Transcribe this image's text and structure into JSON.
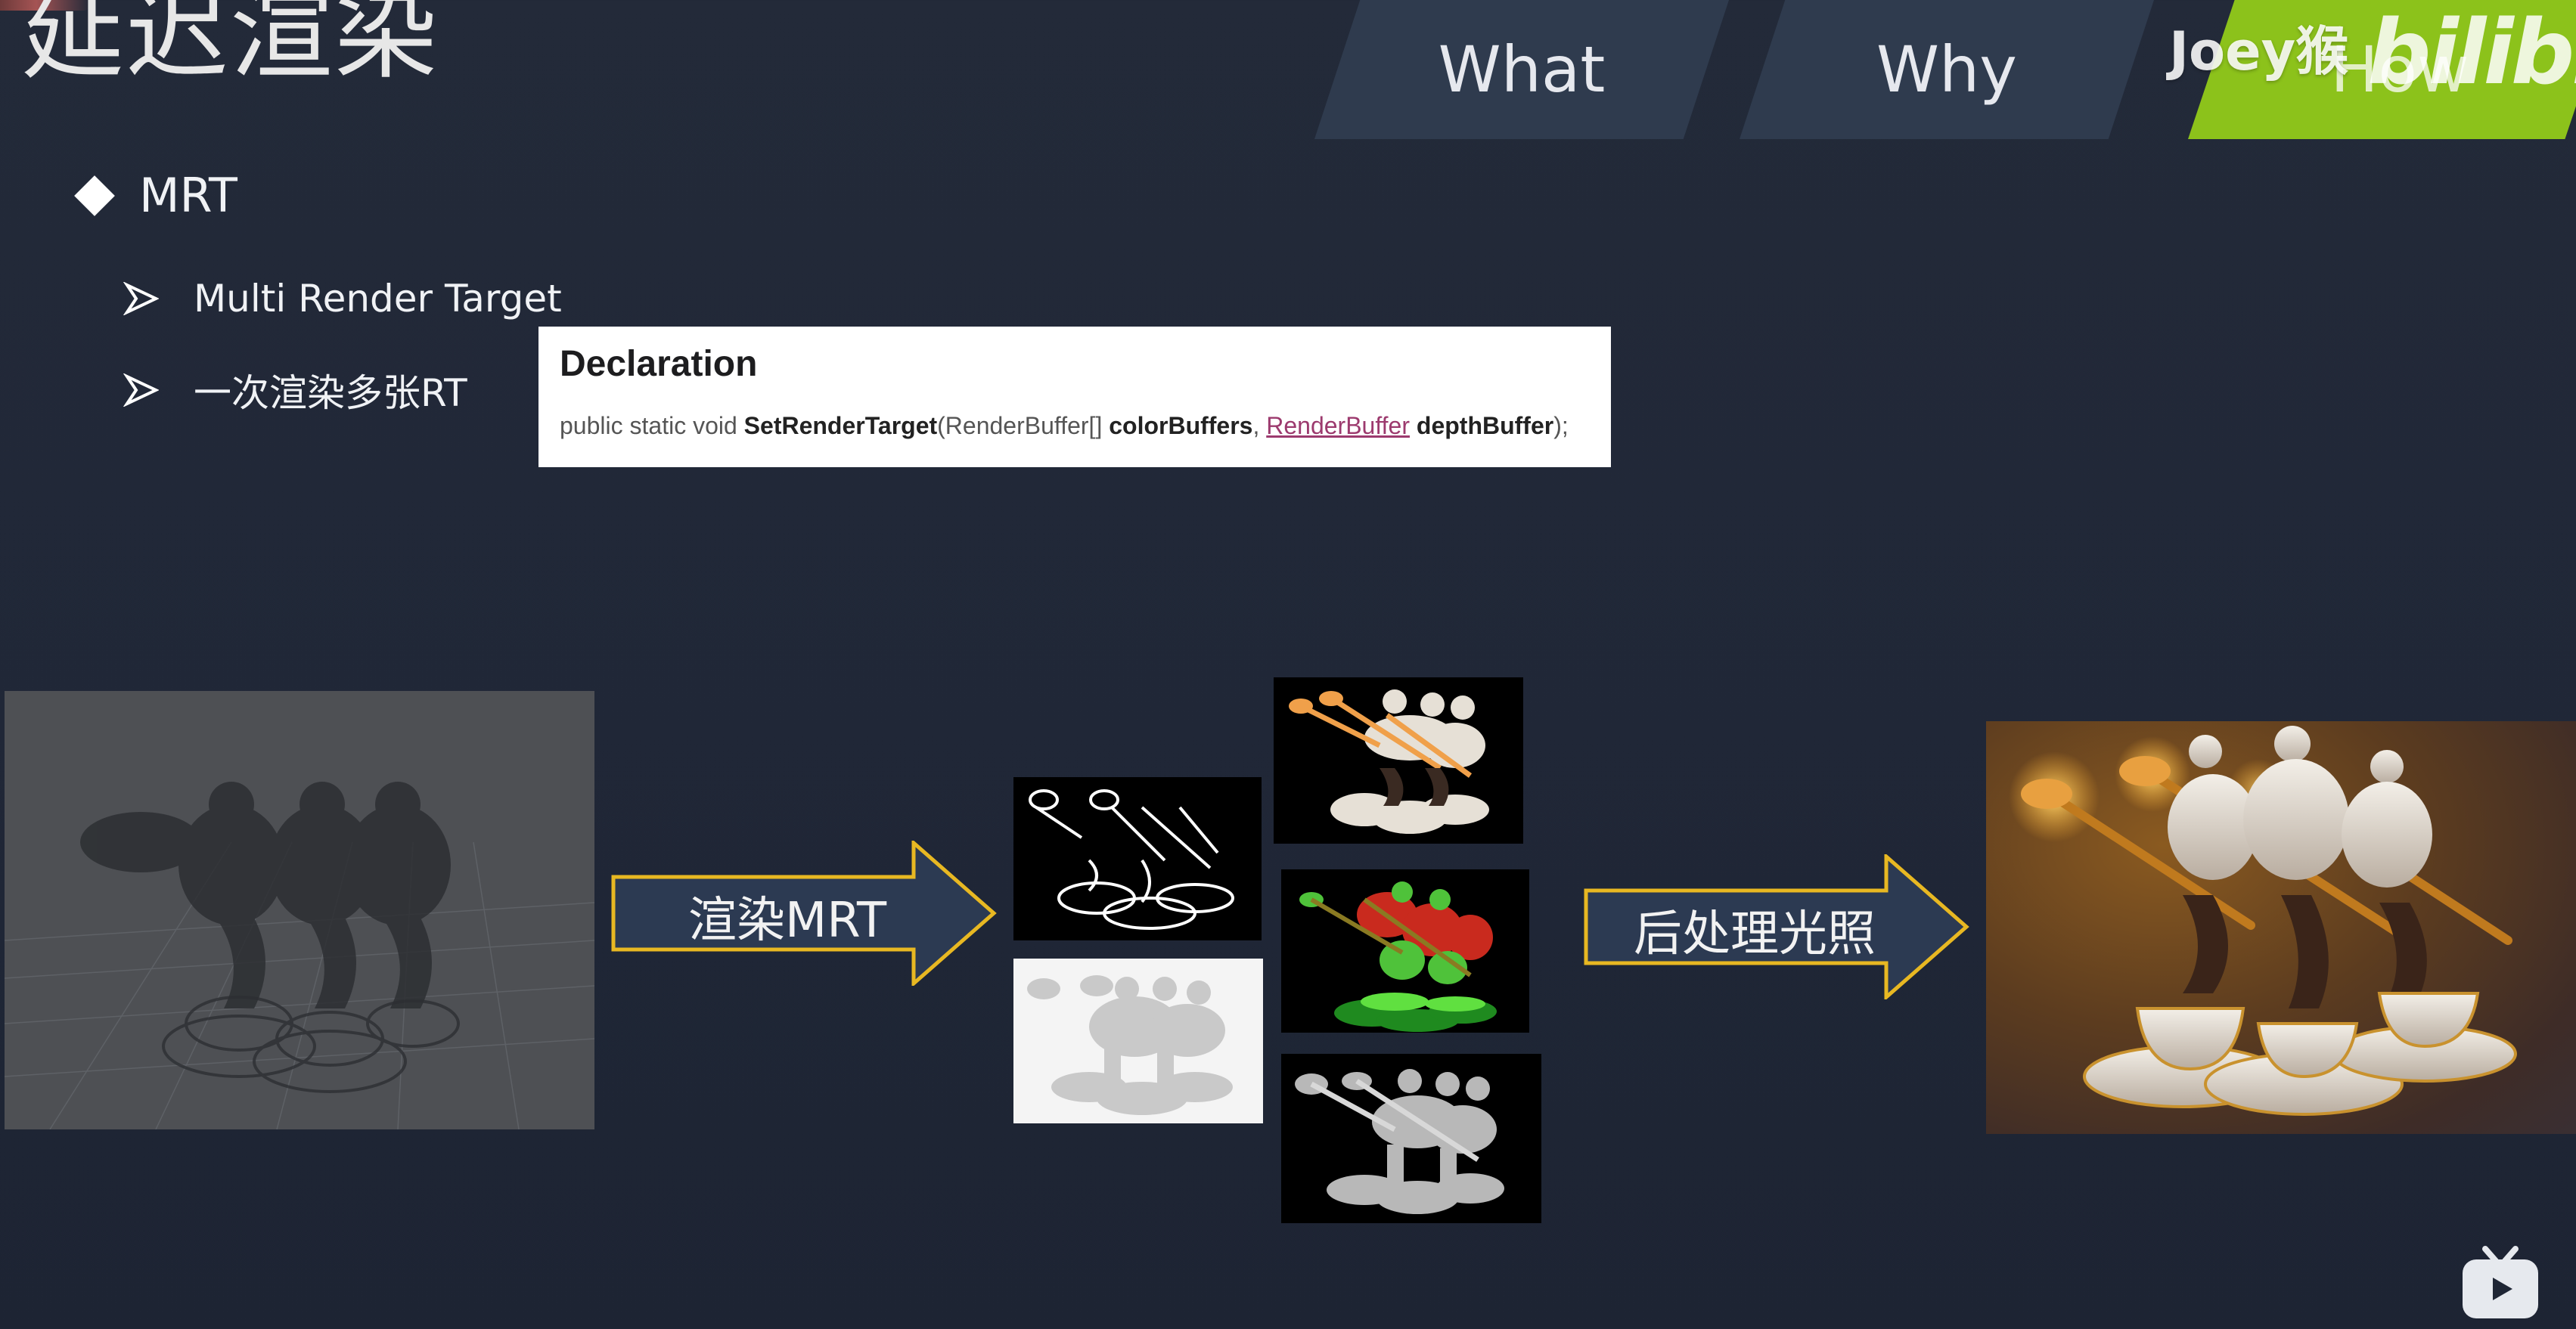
{
  "slide": {
    "title": "延迟渲染",
    "tabs": [
      "What",
      "Why",
      "How"
    ],
    "active_tab": "How",
    "bullet_main": "MRT",
    "sub_bullets": [
      "Multi Render Target",
      "一次渲染多张RT"
    ]
  },
  "declaration": {
    "heading": "Declaration",
    "code_prefix": "public static void ",
    "method": "SetRenderTarget",
    "open_paren": "(",
    "param1_type": "RenderBuffer[] ",
    "param1_name": "colorBuffers",
    "comma": ", ",
    "param2_type": "RenderBuffer",
    "param2_name": " depthBuffer",
    "close": ");"
  },
  "diagram": {
    "arrow1_label": "渲染MRT",
    "arrow2_label": "后处理光照"
  },
  "watermark": {
    "user": "Joey猴",
    "logo": "bilibili"
  },
  "colors": {
    "background": "#212838",
    "tab": "#2f3b4e",
    "tab_active": "#8cc21b",
    "arrow_fill": "#2c3a52",
    "arrow_stroke": "#e8b822",
    "link": "#9c3a6e"
  },
  "icons": [
    "diamond-bullet-icon",
    "arrowhead-bullet-icon",
    "bilibili-tv-icon"
  ]
}
